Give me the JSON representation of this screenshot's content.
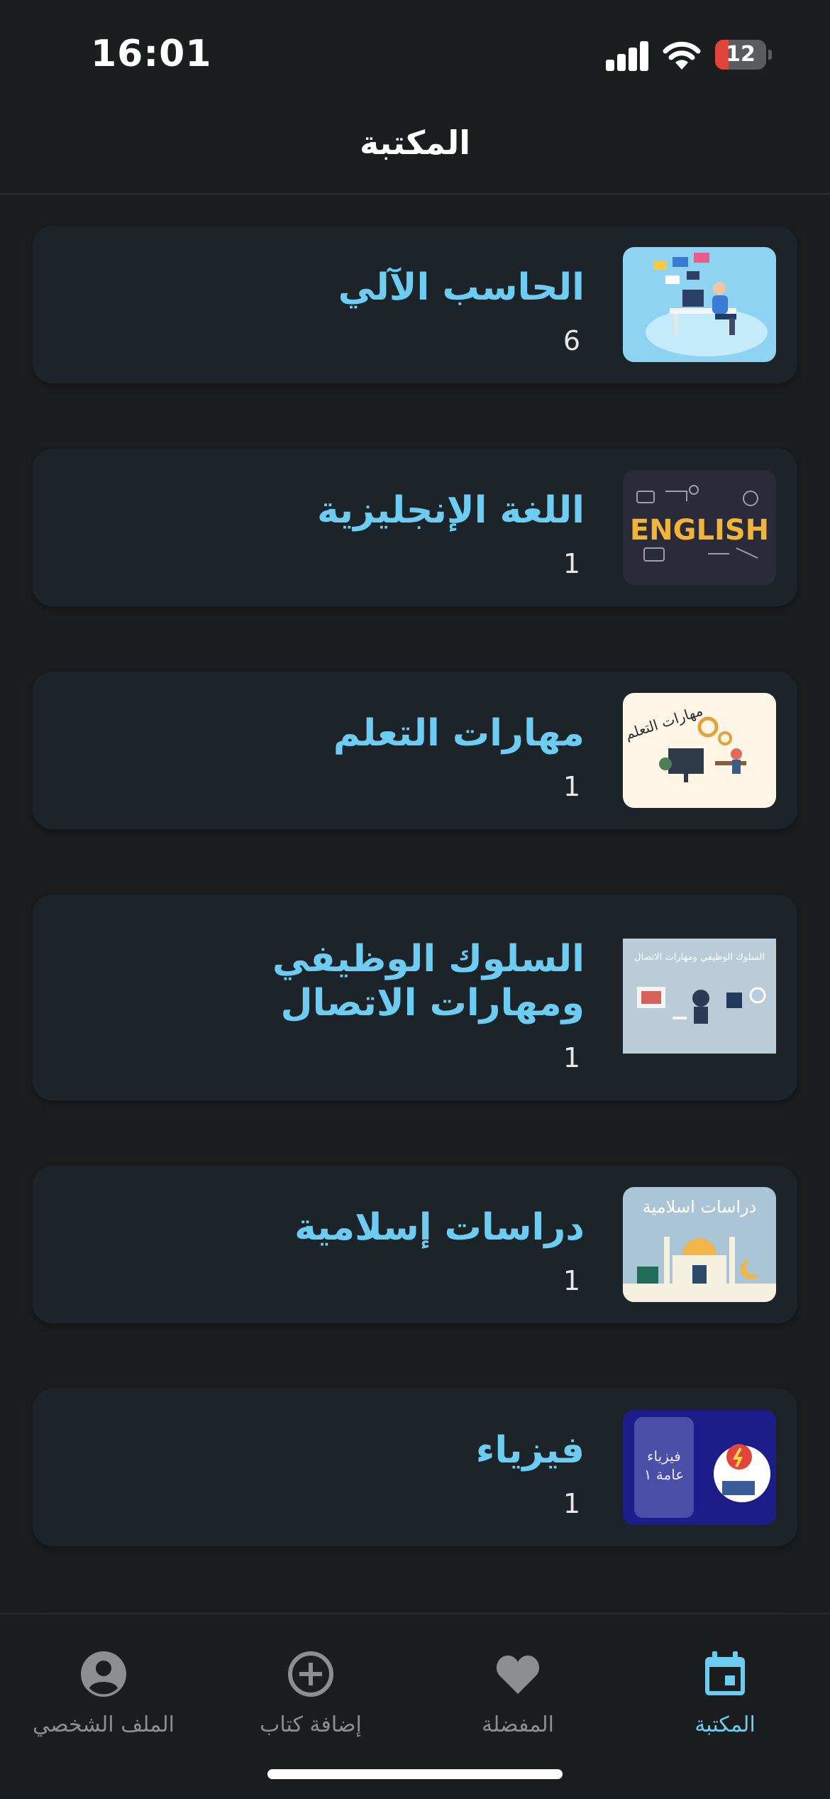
{
  "status_bar": {
    "time": "16:01",
    "battery": "12",
    "battery_level": 0.12
  },
  "header": {
    "title": "المكتبة"
  },
  "library": [
    {
      "title": "الحاسب الآلي",
      "count": "6",
      "thumb_icon": "computer-user-illustration"
    },
    {
      "title": "اللغة الإنجليزية",
      "count": "1",
      "thumb_icon": "english-word-illustration",
      "thumb_text": "ENGLISH"
    },
    {
      "title": "مهارات التعلم",
      "count": "1",
      "thumb_icon": "learning-skills-illustration",
      "thumb_text": "مهارات التعلم"
    },
    {
      "title": "السلوك الوظيفي ومهارات الاتصال",
      "count": "1",
      "thumb_icon": "communication-skills-illustration",
      "thumb_text": "السلوك الوظيفي ومهارات الاتصال"
    },
    {
      "title": "دراسات إسلامية",
      "count": "1",
      "thumb_icon": "mosque-illustration",
      "thumb_text": "دراسات اسلامية"
    },
    {
      "title": "فيزياء",
      "count": "1",
      "thumb_icon": "physics-illustration",
      "thumb_text_line1": "فيزياء",
      "thumb_text_line2": "عامة ١"
    }
  ],
  "tabs": [
    {
      "label": "الملف الشخصي",
      "icon": "profile-icon",
      "active": false
    },
    {
      "label": "إضافة كتاب",
      "icon": "add-circle-icon",
      "active": false
    },
    {
      "label": "المفضلة",
      "icon": "heart-icon",
      "active": false
    },
    {
      "label": "المكتبة",
      "icon": "calendar-icon",
      "active": true
    }
  ],
  "colors": {
    "accent": "#6cccf1",
    "background": "#1c1d1f",
    "card": "#1d2429",
    "inactive": "#8d8e91"
  }
}
